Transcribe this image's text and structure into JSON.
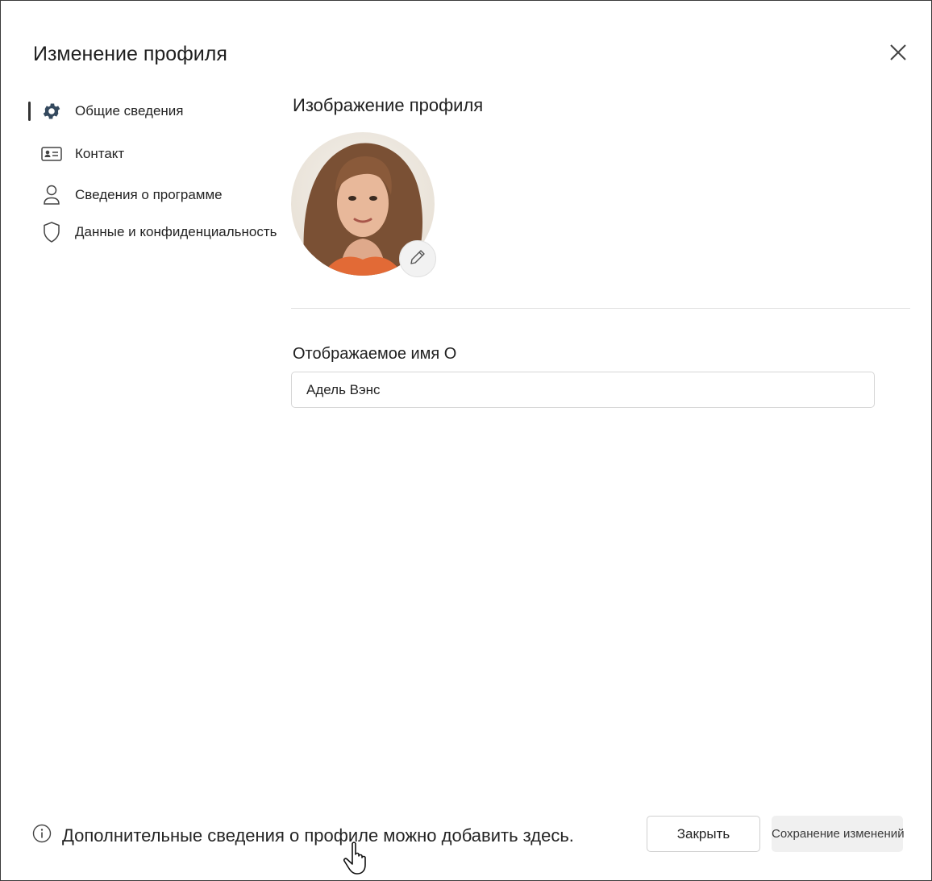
{
  "dialog": {
    "title": "Изменение профиля",
    "close_icon": "close-icon"
  },
  "sidebar": {
    "items": [
      {
        "label": "Общие сведения",
        "icon": "gear-icon",
        "active": true
      },
      {
        "label": "Контакт",
        "icon": "contact-card-icon",
        "active": false
      },
      {
        "label": "Сведения о программе",
        "icon": "person-icon",
        "active": false
      },
      {
        "label": "Данные и конфиденциальность",
        "icon": "shield-icon",
        "active": false
      }
    ]
  },
  "main": {
    "profile_image_title": "Изображение профиля",
    "edit_icon": "pencil-icon",
    "display_name_label": "Отображаемое имя О",
    "display_name_value": "Адель Вэнс"
  },
  "footer": {
    "info_icon": "info-icon",
    "info_text": "Дополнительные сведения о профиле можно добавить здесь.",
    "close_label": "Закрыть",
    "save_label": "Сохранение изменений"
  },
  "colors": {
    "active_indicator": "#333333",
    "icon_active": "#34495e",
    "save_button_bg": "#f0f0f0"
  }
}
